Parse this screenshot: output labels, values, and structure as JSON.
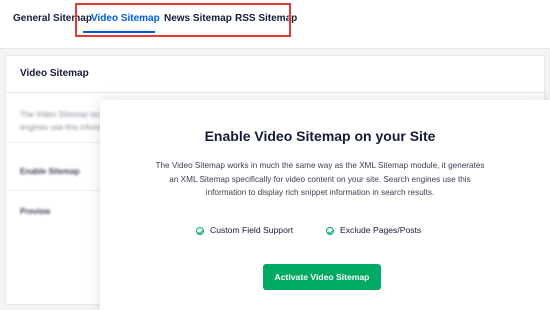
{
  "tabs": [
    {
      "label": "General Sitemap",
      "active": false
    },
    {
      "label": "Video Sitemap",
      "active": true
    },
    {
      "label": "News Sitemap",
      "active": false
    },
    {
      "label": "RSS Sitemap",
      "active": false
    }
  ],
  "panel": {
    "title": "Video Sitemap",
    "background_description": "The Video Sitemap wo\nengines use this informa",
    "settings_rows": [
      {
        "label": "Enable Sitemap"
      },
      {
        "label": "Preview"
      }
    ]
  },
  "modal": {
    "title": "Enable Video Sitemap on your Site",
    "description": "The Video Sitemap works in much the same way as the XML Sitemap module, it generates an XML Sitemap specifically for video content on your site. Search engines use this information to display rich snippet information in search results.",
    "features": [
      {
        "label": "Custom Field Support",
        "icon": "check-circle-icon"
      },
      {
        "label": "Exclude Pages/Posts",
        "icon": "check-circle-icon"
      }
    ],
    "button_label": "Activate Video Sitemap"
  },
  "colors": {
    "accent_blue": "#005ae0",
    "highlight_red": "#e53935",
    "button_green": "#00aa63",
    "text_dark": "#141b38"
  }
}
